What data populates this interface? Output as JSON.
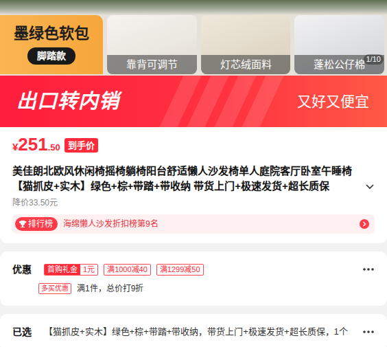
{
  "gallery": {
    "headline": "墨绿色软包",
    "variant": "脚踏款",
    "features": [
      "靠背可调节",
      "灯芯绒面料",
      "蓬松公仔棉"
    ],
    "counter": "1/10"
  },
  "promo_banner": {
    "title": "出口转内销",
    "slogan": "又好又便宜"
  },
  "price": {
    "currency": "¥",
    "integer": "251",
    "decimal": ".50",
    "label": "到手价"
  },
  "product_title": "美佳朗北欧风休闲椅摇椅躺椅阳台舒适懒人沙发椅单人庭院客厅卧室午睡椅【猫抓皮+实木】绿色+棕+带踏+带收纳 带货上门+极速发货+超长质保",
  "price_drop": "降价33.50元",
  "ranking": {
    "tag": "排行榜",
    "text": "海绵懒人沙发折扣榜第9名"
  },
  "offers": {
    "label": "优惠",
    "gift": {
      "label": "首购礼金",
      "value": "1元"
    },
    "coupons": [
      "满1000减40",
      "满1299减50"
    ],
    "multi_buy": {
      "tag": "多买优惠",
      "text": "满1件，总价打9折"
    }
  },
  "selected": {
    "label": "已选",
    "text": "【猫抓皮+实木】绿色+棕+带踏+带收纳，带货上门+极速发货+超长质保，1个"
  }
}
